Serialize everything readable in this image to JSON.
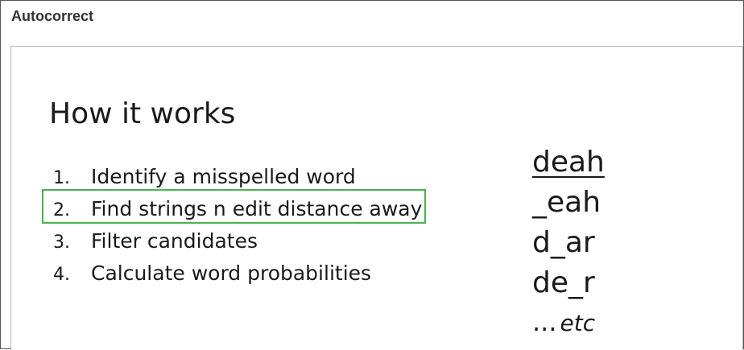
{
  "header": {
    "title": "Autocorrect"
  },
  "slide": {
    "title": "How it works",
    "steps": [
      {
        "number": "1.",
        "text": "Identify a misspelled word",
        "highlighted": false
      },
      {
        "number": "2.",
        "text": "Find strings n edit distance away",
        "highlighted": true
      },
      {
        "number": "3.",
        "text": "Filter candidates",
        "highlighted": false
      },
      {
        "number": "4.",
        "text": "Calculate word probabilities",
        "highlighted": false
      }
    ],
    "highlight_color": "#4caf50",
    "edits": {
      "original": "deah",
      "variants": [
        "_eah",
        "d_ar",
        "de_r"
      ],
      "ellipsis": "...",
      "etc": "etc"
    }
  }
}
